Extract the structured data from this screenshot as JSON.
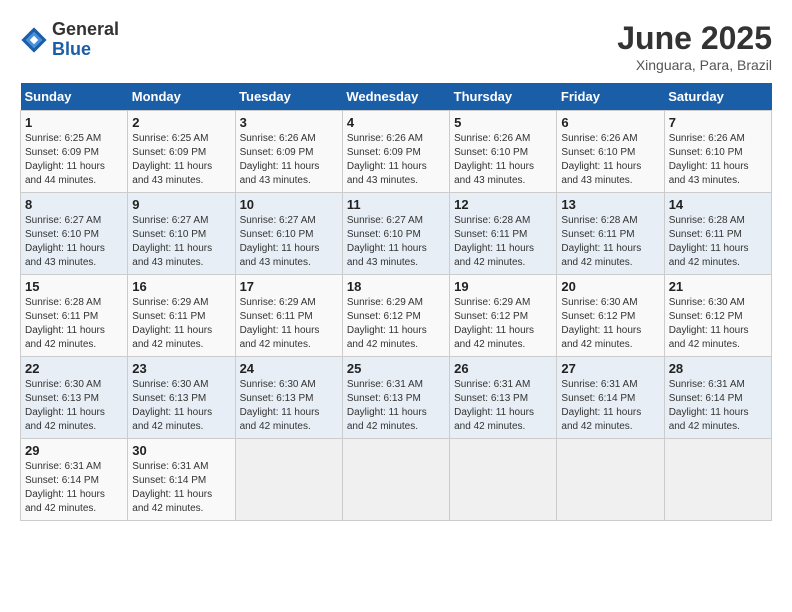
{
  "logo": {
    "general": "General",
    "blue": "Blue"
  },
  "title": "June 2025",
  "location": "Xinguara, Para, Brazil",
  "days_of_week": [
    "Sunday",
    "Monday",
    "Tuesday",
    "Wednesday",
    "Thursday",
    "Friday",
    "Saturday"
  ],
  "weeks": [
    [
      {
        "day": "1",
        "sunrise": "6:25 AM",
        "sunset": "6:09 PM",
        "daylight": "11 hours and 44 minutes."
      },
      {
        "day": "2",
        "sunrise": "6:25 AM",
        "sunset": "6:09 PM",
        "daylight": "11 hours and 43 minutes."
      },
      {
        "day": "3",
        "sunrise": "6:26 AM",
        "sunset": "6:09 PM",
        "daylight": "11 hours and 43 minutes."
      },
      {
        "day": "4",
        "sunrise": "6:26 AM",
        "sunset": "6:09 PM",
        "daylight": "11 hours and 43 minutes."
      },
      {
        "day": "5",
        "sunrise": "6:26 AM",
        "sunset": "6:10 PM",
        "daylight": "11 hours and 43 minutes."
      },
      {
        "day": "6",
        "sunrise": "6:26 AM",
        "sunset": "6:10 PM",
        "daylight": "11 hours and 43 minutes."
      },
      {
        "day": "7",
        "sunrise": "6:26 AM",
        "sunset": "6:10 PM",
        "daylight": "11 hours and 43 minutes."
      }
    ],
    [
      {
        "day": "8",
        "sunrise": "6:27 AM",
        "sunset": "6:10 PM",
        "daylight": "11 hours and 43 minutes."
      },
      {
        "day": "9",
        "sunrise": "6:27 AM",
        "sunset": "6:10 PM",
        "daylight": "11 hours and 43 minutes."
      },
      {
        "day": "10",
        "sunrise": "6:27 AM",
        "sunset": "6:10 PM",
        "daylight": "11 hours and 43 minutes."
      },
      {
        "day": "11",
        "sunrise": "6:27 AM",
        "sunset": "6:10 PM",
        "daylight": "11 hours and 43 minutes."
      },
      {
        "day": "12",
        "sunrise": "6:28 AM",
        "sunset": "6:11 PM",
        "daylight": "11 hours and 42 minutes."
      },
      {
        "day": "13",
        "sunrise": "6:28 AM",
        "sunset": "6:11 PM",
        "daylight": "11 hours and 42 minutes."
      },
      {
        "day": "14",
        "sunrise": "6:28 AM",
        "sunset": "6:11 PM",
        "daylight": "11 hours and 42 minutes."
      }
    ],
    [
      {
        "day": "15",
        "sunrise": "6:28 AM",
        "sunset": "6:11 PM",
        "daylight": "11 hours and 42 minutes."
      },
      {
        "day": "16",
        "sunrise": "6:29 AM",
        "sunset": "6:11 PM",
        "daylight": "11 hours and 42 minutes."
      },
      {
        "day": "17",
        "sunrise": "6:29 AM",
        "sunset": "6:11 PM",
        "daylight": "11 hours and 42 minutes."
      },
      {
        "day": "18",
        "sunrise": "6:29 AM",
        "sunset": "6:12 PM",
        "daylight": "11 hours and 42 minutes."
      },
      {
        "day": "19",
        "sunrise": "6:29 AM",
        "sunset": "6:12 PM",
        "daylight": "11 hours and 42 minutes."
      },
      {
        "day": "20",
        "sunrise": "6:30 AM",
        "sunset": "6:12 PM",
        "daylight": "11 hours and 42 minutes."
      },
      {
        "day": "21",
        "sunrise": "6:30 AM",
        "sunset": "6:12 PM",
        "daylight": "11 hours and 42 minutes."
      }
    ],
    [
      {
        "day": "22",
        "sunrise": "6:30 AM",
        "sunset": "6:13 PM",
        "daylight": "11 hours and 42 minutes."
      },
      {
        "day": "23",
        "sunrise": "6:30 AM",
        "sunset": "6:13 PM",
        "daylight": "11 hours and 42 minutes."
      },
      {
        "day": "24",
        "sunrise": "6:30 AM",
        "sunset": "6:13 PM",
        "daylight": "11 hours and 42 minutes."
      },
      {
        "day": "25",
        "sunrise": "6:31 AM",
        "sunset": "6:13 PM",
        "daylight": "11 hours and 42 minutes."
      },
      {
        "day": "26",
        "sunrise": "6:31 AM",
        "sunset": "6:13 PM",
        "daylight": "11 hours and 42 minutes."
      },
      {
        "day": "27",
        "sunrise": "6:31 AM",
        "sunset": "6:14 PM",
        "daylight": "11 hours and 42 minutes."
      },
      {
        "day": "28",
        "sunrise": "6:31 AM",
        "sunset": "6:14 PM",
        "daylight": "11 hours and 42 minutes."
      }
    ],
    [
      {
        "day": "29",
        "sunrise": "6:31 AM",
        "sunset": "6:14 PM",
        "daylight": "11 hours and 42 minutes."
      },
      {
        "day": "30",
        "sunrise": "6:31 AM",
        "sunset": "6:14 PM",
        "daylight": "11 hours and 42 minutes."
      },
      null,
      null,
      null,
      null,
      null
    ]
  ]
}
